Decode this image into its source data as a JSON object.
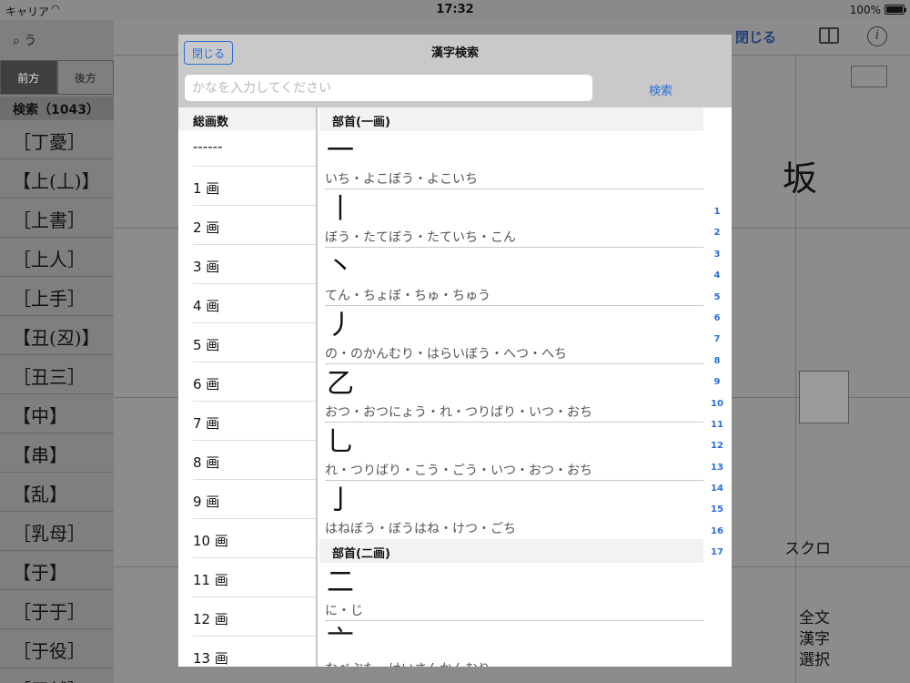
{
  "status_bar": {
    "carrier": "キャリア",
    "time": "17:32",
    "battery": "100%"
  },
  "background": {
    "search_text": "う",
    "tabs": [
      "前方",
      "後方"
    ],
    "result_count": "検索（1043）",
    "list_items": [
      "［丁憂］",
      "【上(丄)】",
      "［上書］",
      "［上人］",
      "［上手］",
      "【丑(丒)】",
      "［丑三］",
      "【中】",
      "【串】",
      "【乱】",
      "［乳母］",
      "【于】",
      "［于于］",
      "［于役］",
      "［于越］"
    ],
    "close_label": "閉じる",
    "kanji": "坂",
    "scroll_label": "スクロ",
    "bottom_labels": [
      "全文",
      "漢字",
      "選択"
    ]
  },
  "modal": {
    "title": "漢字検索",
    "close_label": "閉じる",
    "search_placeholder": "かなを入力してください",
    "search_label": "検索",
    "stroke_header": "総画数",
    "stroke_items": [
      "------",
      "1 画",
      "2 画",
      "3 画",
      "4 画",
      "5 画",
      "6 画",
      "7 画",
      "8 画",
      "9 画",
      "10 画",
      "11 画",
      "12 画",
      "13 画"
    ],
    "sections": [
      {
        "header": "部首(一画)",
        "radicals": [
          {
            "char": "一",
            "reading": "いち・よこぼう・よこいち"
          },
          {
            "char": "丨",
            "reading": "ぼう・たてぼう・たていち・こん"
          },
          {
            "char": "丶",
            "reading": "てん・ちょぼ・ちゅ・ちゅう"
          },
          {
            "char": "丿",
            "reading": "の・のかんむり・はらいぼう・へつ・へち"
          },
          {
            "char": "乙",
            "reading": "おつ・おつにょう・れ・つりばり・いつ・おち"
          },
          {
            "char": "乚",
            "reading": "れ・つりばり・こう・ごう・いつ・おつ・おち"
          },
          {
            "char": "亅",
            "reading": "はねぼう・ぼうはね・けつ・ごち"
          }
        ]
      },
      {
        "header": "部首(二画)",
        "radicals": [
          {
            "char": "二",
            "reading": "に・じ"
          },
          {
            "char": "亠",
            "reading": "なべぶた・けいさんかんむり"
          }
        ]
      }
    ],
    "index": [
      "1",
      "2",
      "3",
      "4",
      "5",
      "6",
      "7",
      "8",
      "9",
      "10",
      "11",
      "12",
      "13",
      "14",
      "15",
      "16",
      "17"
    ]
  }
}
